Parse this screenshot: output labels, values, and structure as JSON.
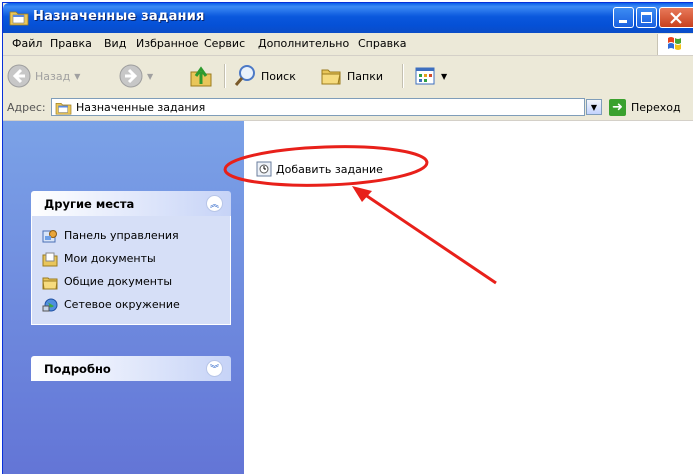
{
  "window": {
    "title": "Назначенные задания"
  },
  "menu": {
    "items": [
      "Файл",
      "Правка",
      "Вид",
      "Избранное",
      "Сервис",
      "Дополнительно",
      "Справка"
    ]
  },
  "toolbar": {
    "back_label": "Назад",
    "search_label": "Поиск",
    "folders_label": "Папки"
  },
  "address": {
    "label": "Адрес:",
    "value": "Назначенные задания",
    "go_label": "Переход"
  },
  "sidebar": {
    "other_places": {
      "title": "Другие места",
      "links": [
        "Панель управления",
        "Мои документы",
        "Общие документы",
        "Сетевое окружение"
      ]
    },
    "details": {
      "title": "Подробно"
    }
  },
  "content": {
    "items": [
      "Добавить задание"
    ]
  },
  "colors": {
    "titlebar": "#0A58DD",
    "sidebar_gradient_top": "#7BA2E7",
    "sidebar_gradient_bottom": "#6375D6",
    "annotation": "#E8201A"
  }
}
